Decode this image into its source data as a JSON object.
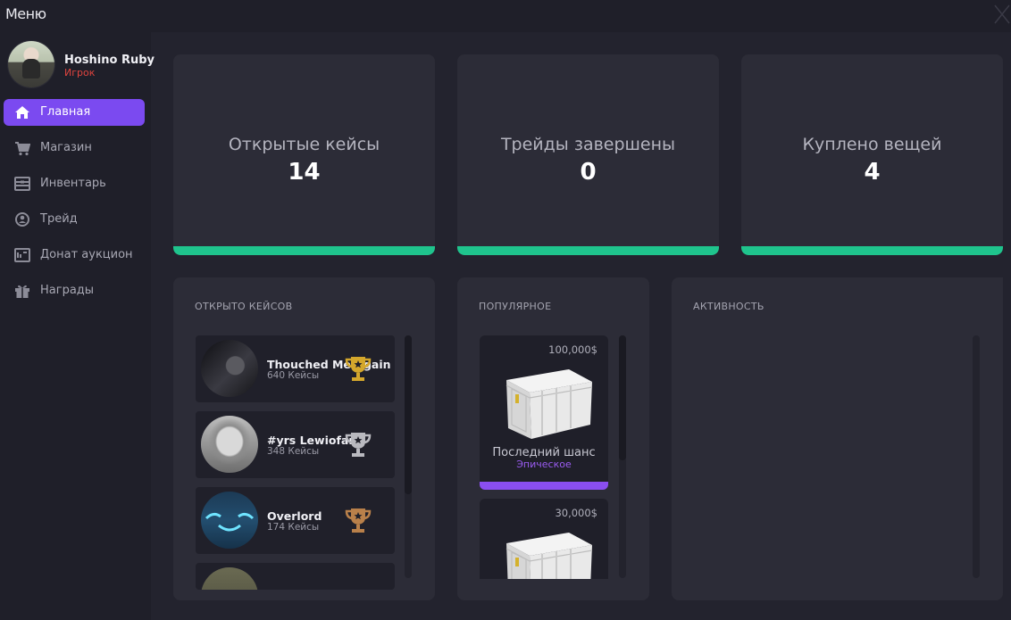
{
  "window": {
    "title": "Меню"
  },
  "user": {
    "name": "Hoshino Ruby",
    "role": "Игрок"
  },
  "nav": [
    {
      "label": "Главная",
      "icon": "home-icon",
      "active": true
    },
    {
      "label": "Магазин",
      "icon": "cart-icon",
      "active": false
    },
    {
      "label": "Инвентарь",
      "icon": "inventory-icon",
      "active": false
    },
    {
      "label": "Трейд",
      "icon": "trade-icon",
      "active": false
    },
    {
      "label": "Донат аукцион",
      "icon": "auction-icon",
      "active": false
    },
    {
      "label": "Награды",
      "icon": "gift-icon",
      "active": false
    }
  ],
  "stats": [
    {
      "label": "Открытые кейсы",
      "value": "14"
    },
    {
      "label": "Трейды завершены",
      "value": "0"
    },
    {
      "label": "Куплено вещей",
      "value": "4"
    }
  ],
  "opened_cases": {
    "title": "ОТКРЫТО КЕЙСОВ",
    "rows": [
      {
        "name": "Thouched Me Again",
        "count": "640 Кейсы",
        "trophy": "gold-trophy-icon"
      },
      {
        "name": "#yrs Lewiofan",
        "count": "348 Кейсы",
        "trophy": "silver-trophy-icon"
      },
      {
        "name": "Overlord",
        "count": "174 Кейсы",
        "trophy": "bronze-trophy-icon"
      }
    ]
  },
  "popular": {
    "title": "ПОПУЛЯРНОЕ",
    "cases": [
      {
        "price": "100,000$",
        "name": "Последний шанс",
        "rarity": "Эпическое"
      },
      {
        "price": "30,000$",
        "name": "",
        "rarity": ""
      }
    ]
  },
  "activity": {
    "title": "АКТИВНОСТЬ"
  },
  "colors": {
    "accent": "#7b4af0",
    "stat_bar": "#1fc48d",
    "role": "#e0443e",
    "epic": "#9b5cf2"
  }
}
